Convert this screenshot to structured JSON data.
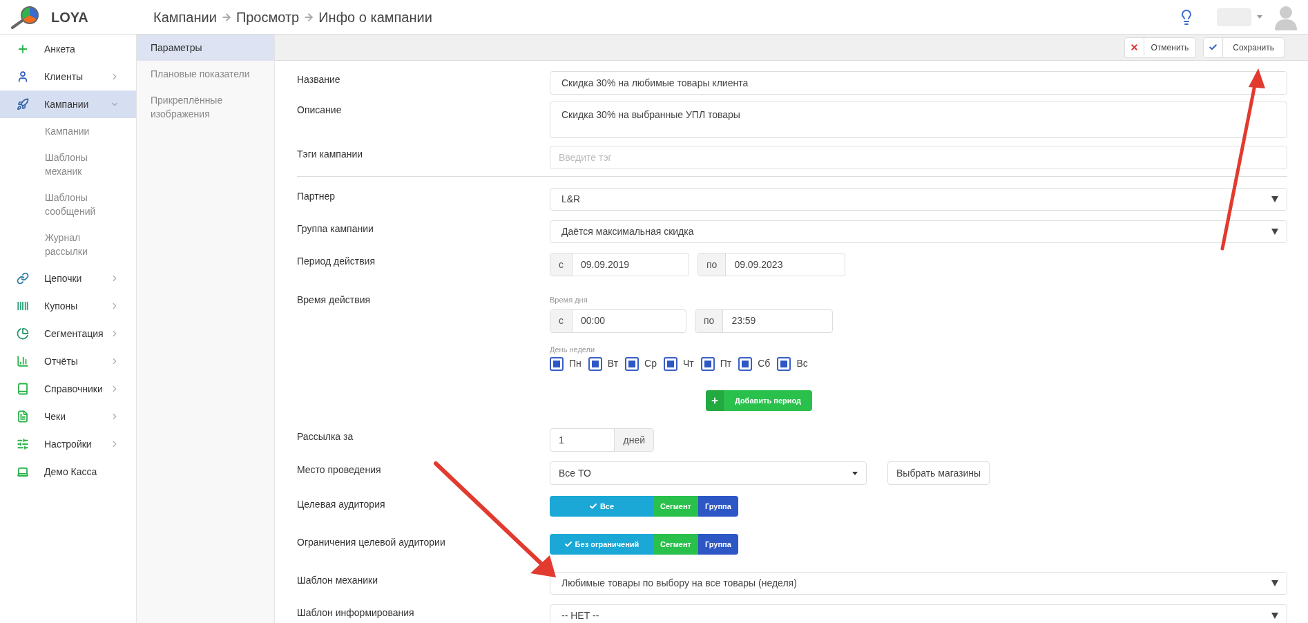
{
  "header": {
    "logo": "LOYA",
    "breadcrumbs": [
      "Кампании",
      "Просмотр",
      "Инфо о кампании"
    ]
  },
  "sidebar": {
    "items": [
      {
        "label": "Анкета",
        "expandable": false,
        "expanded": false,
        "selected": false
      },
      {
        "label": "Клиенты",
        "expandable": true,
        "expanded": false,
        "selected": false
      },
      {
        "label": "Кампании",
        "expandable": true,
        "expanded": true,
        "selected": true,
        "children": [
          {
            "label": "Кампании"
          },
          {
            "label": "Шаблоны механик"
          },
          {
            "label": "Шаблоны сообщений"
          },
          {
            "label": "Журнал рассылки"
          }
        ]
      },
      {
        "label": "Цепочки",
        "expandable": true,
        "expanded": false,
        "selected": false
      },
      {
        "label": "Купоны",
        "expandable": true,
        "expanded": false,
        "selected": false
      },
      {
        "label": "Сегментация",
        "expandable": true,
        "expanded": false,
        "selected": false
      },
      {
        "label": "Отчёты",
        "expandable": true,
        "expanded": false,
        "selected": false
      },
      {
        "label": "Справочники",
        "expandable": true,
        "expanded": false,
        "selected": false
      },
      {
        "label": "Чеки",
        "expandable": true,
        "expanded": false,
        "selected": false
      },
      {
        "label": "Настройки",
        "expandable": true,
        "expanded": false,
        "selected": false
      },
      {
        "label": "Демо Касса",
        "expandable": false,
        "expanded": false,
        "selected": false
      }
    ]
  },
  "subnav": [
    {
      "label": "Параметры",
      "selected": true
    },
    {
      "label": "Плановые показатели",
      "selected": false
    },
    {
      "label": "Прикреплённые изображения",
      "selected": false
    }
  ],
  "toolbar": {
    "cancel": "Отменить",
    "save": "Сохранить"
  },
  "form": [
    {
      "kind": "text",
      "label": "Название",
      "value": "Скидка 30% на любимые товары клиента"
    },
    {
      "kind": "textarea",
      "label": "Описание",
      "value": "Скидка 30% на выбранные УПЛ товары"
    },
    {
      "kind": "tags",
      "label": "Тэги кампании",
      "placeholder": "Введите тэг"
    },
    {
      "kind": "divider"
    },
    {
      "kind": "select",
      "label": "Партнер",
      "value": "L&R"
    },
    {
      "kind": "select",
      "label": "Группа кампании",
      "value": "Даётся максимальная скидка"
    },
    {
      "kind": "range",
      "label": "Период действия",
      "from_label": "с",
      "from": "09.09.2019",
      "to_label": "по",
      "to": "09.09.2023"
    },
    {
      "kind": "time",
      "label": "Время действия",
      "time_caption": "Время дня",
      "from_label": "с",
      "from": "00:00",
      "to_label": "по",
      "to": "23:59",
      "days_caption": "День недели",
      "days": [
        {
          "label": "Пн",
          "checked": true
        },
        {
          "label": "Вт",
          "checked": true
        },
        {
          "label": "Ср",
          "checked": true
        },
        {
          "label": "Чт",
          "checked": true
        },
        {
          "label": "Пт",
          "checked": true
        },
        {
          "label": "Сб",
          "checked": true
        },
        {
          "label": "Вс",
          "checked": true
        }
      ],
      "add_button": "Добавить период"
    },
    {
      "kind": "number",
      "label": "Рассылка за",
      "value": "1",
      "unit": "дней"
    },
    {
      "kind": "place",
      "label": "Место проведения",
      "value": "Все ТО",
      "button": "Выбрать магазины"
    },
    {
      "kind": "toggle",
      "label": "Целевая аудитория",
      "options": [
        {
          "label": "Все",
          "selected": true,
          "color": "#1ba8d6"
        },
        {
          "label": "Сегмент",
          "selected": false,
          "color": "#29c04b"
        },
        {
          "label": "Группа",
          "selected": false,
          "color": "#2d57c5"
        }
      ]
    },
    {
      "kind": "toggle",
      "label": "Ограничения целевой аудитории",
      "options": [
        {
          "label": "Без ограничений",
          "selected": true,
          "color": "#1ba8d6"
        },
        {
          "label": "Сегмент",
          "selected": false,
          "color": "#29c04b"
        },
        {
          "label": "Группа",
          "selected": false,
          "color": "#2d57c5"
        }
      ]
    },
    {
      "kind": "select",
      "label": "Шаблон механики",
      "value": "Любимые товары по выбору на все товары (неделя)"
    },
    {
      "kind": "select",
      "label": "Шаблон информирования",
      "value": "-- НЕТ --"
    }
  ]
}
